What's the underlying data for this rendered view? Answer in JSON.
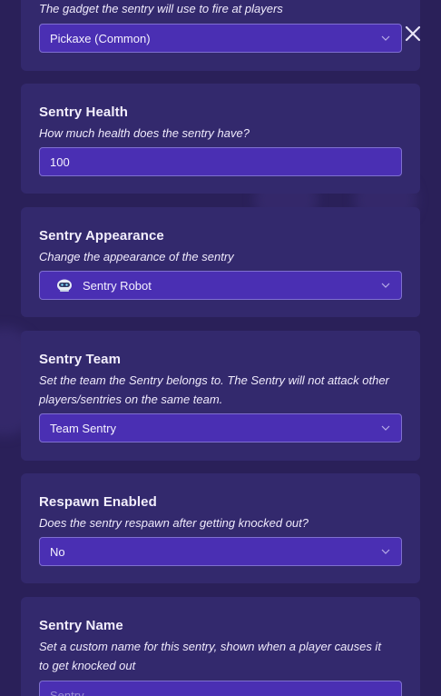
{
  "close": {
    "icon": "close-icon"
  },
  "fields": [
    {
      "title": "",
      "description": "The gadget the sentry will use to fire at players",
      "value": "Pickaxe (Common)",
      "type": "select"
    },
    {
      "title": "Sentry Health",
      "description": "How much health does the sentry have?",
      "value": "100",
      "type": "input"
    },
    {
      "title": "Sentry Appearance",
      "description": "Change the appearance of the sentry",
      "value": "Sentry Robot",
      "type": "select",
      "icon": "sentry-robot-icon"
    },
    {
      "title": "Sentry Team",
      "description_line1": "Set the team the Sentry belongs to. The Sentry will not attack other",
      "description_line2": "players/sentries on the same team.",
      "value": "Team Sentry",
      "type": "select"
    },
    {
      "title": "Respawn Enabled",
      "description": "Does the sentry respawn after getting knocked out?",
      "value": "No",
      "type": "select"
    },
    {
      "title": "Sentry Name",
      "description_line1": "Set a custom name for this sentry, shown when a player causes it",
      "description_line2": "to get knocked out",
      "placeholder": "Sentry",
      "type": "input"
    }
  ],
  "colors": {
    "background": "#2a2059",
    "panel": "#33296d",
    "control": "#4a2fb3",
    "control_border": "#7f6fd0",
    "text": "#f2eefc"
  }
}
